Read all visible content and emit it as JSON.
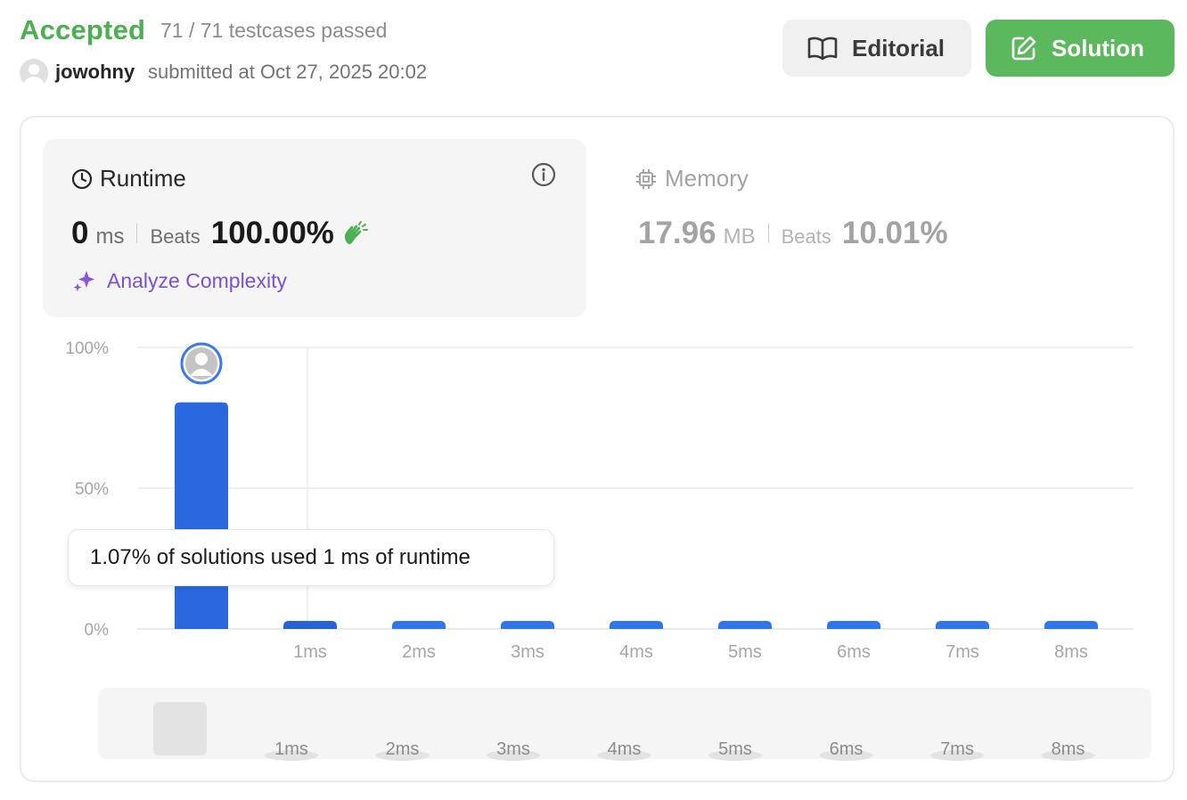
{
  "header": {
    "status": "Accepted",
    "testcases": "71 / 71 testcases passed",
    "username": "jowohny",
    "submitted_at": "submitted at Oct 27, 2025 20:02",
    "editorial_label": "Editorial",
    "solution_label": "Solution"
  },
  "runtime": {
    "title": "Runtime",
    "value": "0",
    "unit": "ms",
    "beats_label": "Beats",
    "beats_value": "100.00%",
    "analyze_label": "Analyze Complexity"
  },
  "memory": {
    "title": "Memory",
    "value": "17.96",
    "unit": "MB",
    "beats_label": "Beats",
    "beats_value": "10.01%"
  },
  "tooltip": "1.07% of solutions used 1 ms of runtime",
  "colors": {
    "accepted": "#4caf50",
    "solution_button": "#5cb85c",
    "bar": "#2f6fe0",
    "bar_selected": "#2563d6",
    "analyze": "#7b4fd8"
  },
  "chart_data": {
    "type": "bar",
    "title": "",
    "y_ticks": [
      "100%",
      "50%",
      "0%"
    ],
    "ylim": [
      0,
      100
    ],
    "categories": [
      "",
      "1ms",
      "2ms",
      "3ms",
      "4ms",
      "5ms",
      "6ms",
      "7ms",
      "8ms"
    ],
    "values": [
      80.5,
      1.07,
      1.0,
      1.0,
      1.0,
      1.0,
      1.0,
      1.5,
      1.0
    ],
    "highlighted_index": 0,
    "grid": true,
    "mini_labels": [
      "1ms",
      "2ms",
      "3ms",
      "4ms",
      "5ms",
      "6ms",
      "7ms",
      "8ms"
    ]
  }
}
